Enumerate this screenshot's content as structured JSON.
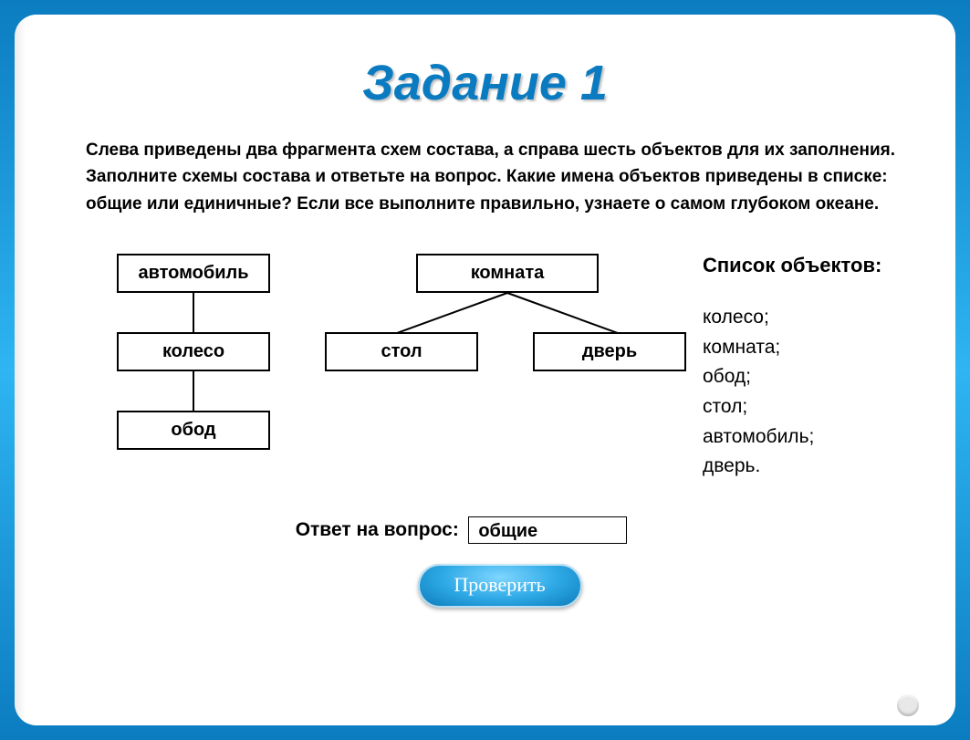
{
  "title": "Задание 1",
  "description": "Слева приведены два фрагмента схем состава, а справа шесть объектов для их заполнения. Заполните схемы состава и ответьте на вопрос. Какие имена объектов приведены в списке: общие или единичные? Если все выполните правильно, узнаете о самом глубоком океане.",
  "diagram": {
    "left_chain": {
      "node1": "автомобиль",
      "node2": "колесо",
      "node3": "обод"
    },
    "right_tree": {
      "root": "комната",
      "child_left": "стол",
      "child_right": "дверь"
    }
  },
  "object_list": {
    "title": "Список объектов:",
    "items": [
      "колесо;",
      "комната;",
      "обод;",
      "стол;",
      "автомобиль;",
      "дверь."
    ]
  },
  "answer": {
    "label": "Ответ на вопрос:",
    "value": "общие"
  },
  "check_button": "Проверить"
}
